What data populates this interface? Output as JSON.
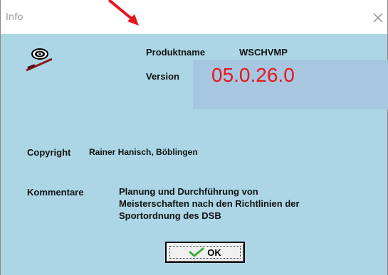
{
  "window": {
    "title": "Info"
  },
  "about": {
    "product_label": "Produktname",
    "product_value": "WSCHVMP",
    "version_label": "Version",
    "version_value": "05.0.26.0",
    "copyright_label": "Copyright",
    "copyright_value": "Rainer Hanisch, Böblingen",
    "comments_label": "Kommentare",
    "comments_lines": [
      "Planung und Durchführung von",
      "Meisterschaften nach den Richtlinien der",
      "Sportordnung des DSB"
    ]
  },
  "buttons": {
    "ok_label": "OK"
  },
  "icons": {
    "logo": "target-icon",
    "close": "close-icon",
    "ok": "checkmark-icon",
    "annotation": "red-arrow"
  },
  "colors": {
    "client_bg": "#acd6e6",
    "version_highlight": "#a7c6e0",
    "version_text": "#e8161c",
    "arrow": "#e8161c"
  }
}
